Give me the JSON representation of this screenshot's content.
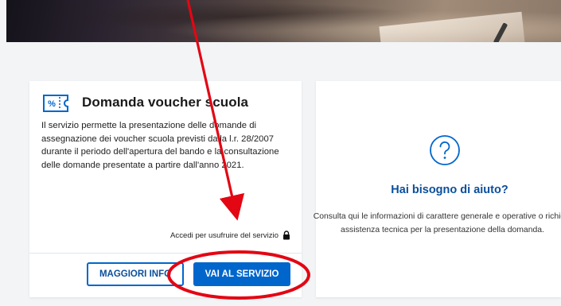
{
  "service_card": {
    "title": "Domanda voucher scuola",
    "icon": "voucher-ticket-icon",
    "description": "Il servizio permette la presentazione delle domande di assegnazione dei voucher scuola previsti dalla l.r. 28/2007 durante il periodo dell'apertura del bando e la consultazione delle domande presentate a partire dall'anno 2021.",
    "access_text": "Accedi per usufruire del servizio",
    "more_info_label": "MAGGIORI INFO",
    "go_to_service_label": "VAI AL SERVIZIO"
  },
  "help_card": {
    "icon": "help-question-icon",
    "title": "Hai bisogno di aiuto?",
    "description": "Consulta qui le informazioni di carattere generale e operative o richiedi assistenza tecnica per la presentazione della domanda."
  },
  "colors": {
    "accent": "#0066cc",
    "annotation": "#e30613",
    "background": "#f2f4f6"
  }
}
